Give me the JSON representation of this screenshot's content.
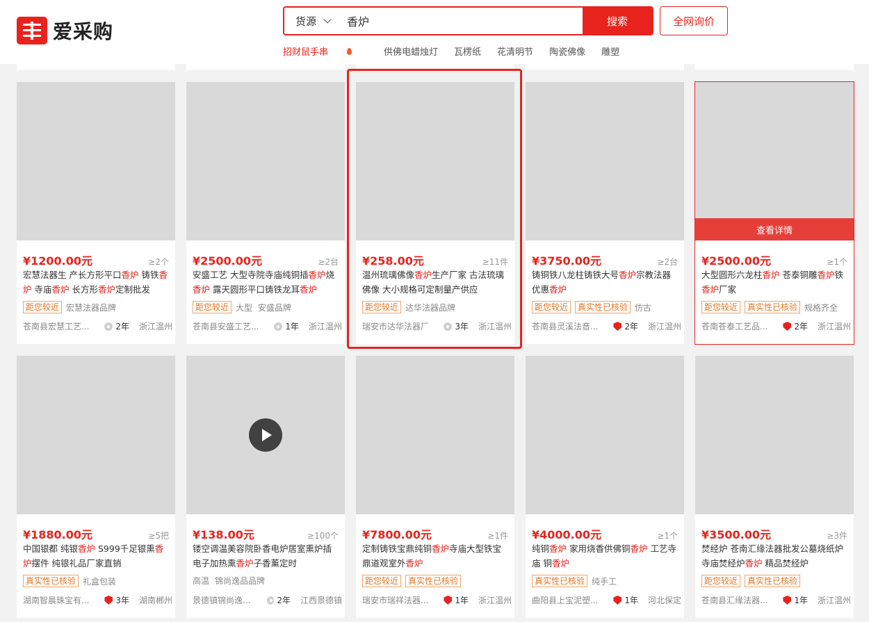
{
  "header": {
    "logo_text": "爱采购",
    "search": {
      "source_label": "货源",
      "query": "香炉",
      "button_label": "搜索"
    },
    "inquiry_label": "全网询价",
    "hot_links": [
      "招财鼠手串",
      "供佛电蜡烛灯",
      "瓦楞纸",
      "花清明节",
      "陶瓷佛像",
      "雕塑"
    ]
  },
  "products": [
    {
      "price": "¥1200.00元",
      "moq": "≥2个",
      "title": [
        [
          "宏慧法器生 产长方形平口",
          0
        ],
        [
          "香炉",
          1
        ],
        [
          " 铸铁",
          0
        ],
        [
          "香炉",
          1
        ],
        [
          " 寺庙",
          0
        ],
        [
          "香炉",
          1
        ],
        [
          " 长方形",
          0
        ],
        [
          "香炉",
          1
        ],
        [
          "定制批发",
          0
        ]
      ],
      "tags": [
        {
          "text": "距您较近",
          "boxed": true
        },
        {
          "text": "宏慧法器品牌",
          "boxed": false
        }
      ],
      "seller": "苍南县宏慧工艺...",
      "badge": "gray",
      "years": "2年",
      "location": "浙江温州"
    },
    {
      "price": "¥2500.00元",
      "moq": "≥2台",
      "title": [
        [
          "安盛工艺 大型寺院寺庙纯铜插",
          0
        ],
        [
          "香炉",
          1
        ],
        [
          "烧",
          0
        ],
        [
          "香炉",
          1
        ],
        [
          " 露天圆形平口铸铁龙耳",
          0
        ],
        [
          "香炉",
          1
        ]
      ],
      "tags": [
        {
          "text": "距您较近",
          "boxed": true
        },
        {
          "text": "大型",
          "boxed": false
        },
        {
          "text": "安盛品牌",
          "boxed": false
        }
      ],
      "seller": "苍南县安盛工艺...",
      "badge": "gray",
      "years": "1年",
      "location": "浙江温州"
    },
    {
      "price": "¥258.00元",
      "moq": "≥11件",
      "title": [
        [
          "温州琉璃佛像",
          0
        ],
        [
          "香炉",
          1
        ],
        [
          "生产厂家 古法琉璃佛像 大小规格可定制量产供应",
          0
        ]
      ],
      "tags": [
        {
          "text": "距您较近",
          "boxed": true
        },
        {
          "text": "达华法器品牌",
          "boxed": false
        }
      ],
      "seller": "瑞安市达华法器厂",
      "badge": "gray",
      "years": "3年",
      "location": "浙江温州"
    },
    {
      "price": "¥3750.00元",
      "moq": "≥2台",
      "title": [
        [
          "铸铜铁八龙柱铸铁大号",
          0
        ],
        [
          "香炉",
          1
        ],
        [
          "宗教法器优惠",
          0
        ],
        [
          "香炉",
          1
        ]
      ],
      "tags": [
        {
          "text": "距您较近",
          "boxed": true
        },
        {
          "text": "真实性已核验",
          "boxed": true
        },
        {
          "text": "仿古",
          "boxed": false
        }
      ],
      "seller": "苍南县灵溪法音...",
      "badge": "red",
      "years": "2年",
      "location": "浙江温州"
    },
    {
      "price": "¥2500.00元",
      "moq": "≥1个",
      "title": [
        [
          "大型圆形六龙柱",
          0
        ],
        [
          "香炉",
          1
        ],
        [
          " 苍泰铜雕",
          0
        ],
        [
          "香炉",
          1
        ],
        [
          "铁",
          0
        ],
        [
          "香炉",
          1
        ],
        [
          "厂家",
          0
        ]
      ],
      "tags": [
        {
          "text": "距您较近",
          "boxed": true
        },
        {
          "text": "真实性已核验",
          "boxed": true
        },
        {
          "text": "规格齐全",
          "boxed": false
        }
      ],
      "seller": "苍南苍泰工艺品...",
      "badge": "red",
      "years": "2年",
      "location": "浙江温州",
      "overlay": "查看详情"
    },
    {
      "price": "¥1880.00元",
      "moq": "≥5把",
      "title": [
        [
          "中国银都 纯银",
          0
        ],
        [
          "香炉",
          1
        ],
        [
          " S999千足银熏",
          0
        ],
        [
          "香炉",
          1
        ],
        [
          "摆件 纯银礼品厂家直销",
          0
        ]
      ],
      "tags": [
        {
          "text": "真实性已核验",
          "boxed": true
        },
        {
          "text": "礼盒包装",
          "boxed": false
        }
      ],
      "seller": "湖南智晨珠宝有...",
      "badge": "red",
      "years": "3年",
      "location": "湖南郴州"
    },
    {
      "price": "¥138.00元",
      "moq": "≥100个",
      "title": [
        [
          "镂空调温美容院卧香电炉居室熏炉插电子加热熏",
          0
        ],
        [
          "香炉",
          1
        ],
        [
          "子香薰定时",
          0
        ]
      ],
      "tags": [
        {
          "text": "高温",
          "boxed": false
        },
        {
          "text": "锦尚逸品品牌",
          "boxed": false
        }
      ],
      "seller": "景德镇锦尚逸...",
      "badge": "gray",
      "years": "2年",
      "location": "江西景德镇",
      "video": true
    },
    {
      "price": "¥7800.00元",
      "moq": "≥1件",
      "title": [
        [
          "定制铸铁宝鼎纯铜",
          0
        ],
        [
          "香炉",
          1
        ],
        [
          "寺庙大型铁宝鼎道观室外",
          0
        ],
        [
          "香炉",
          1
        ]
      ],
      "tags": [
        {
          "text": "距您较近",
          "boxed": true
        },
        {
          "text": "真实性已核验",
          "boxed": true
        }
      ],
      "seller": "瑞安市瑞祥法器...",
      "badge": "red",
      "years": "1年",
      "location": "浙江温州"
    },
    {
      "price": "¥4000.00元",
      "moq": "≥1个",
      "title": [
        [
          "纯铜",
          0
        ],
        [
          "香炉",
          1
        ],
        [
          " 家用烧香供佛铜",
          0
        ],
        [
          "香炉",
          1
        ],
        [
          " 工艺寺庙 铜",
          0
        ],
        [
          "香炉",
          1
        ]
      ],
      "tags": [
        {
          "text": "真实性已核验",
          "boxed": true
        },
        {
          "text": "纯手工",
          "boxed": false
        }
      ],
      "seller": "曲阳县上宝泥塑...",
      "badge": "red",
      "years": "1年",
      "location": "河北保定"
    },
    {
      "price": "¥3500.00元",
      "moq": "≥3件",
      "title": [
        [
          "焚经炉 苍南汇缘法器批发公墓烧纸炉寺庙焚经炉",
          0
        ],
        [
          "香炉",
          1
        ],
        [
          " 精品焚经炉",
          0
        ]
      ],
      "tags": [
        {
          "text": "距您较近",
          "boxed": true
        },
        {
          "text": "真实性已核验",
          "boxed": true
        }
      ],
      "seller": "苍南县汇缘法器...",
      "badge": "red",
      "years": "1年",
      "location": "浙江温州"
    }
  ]
}
